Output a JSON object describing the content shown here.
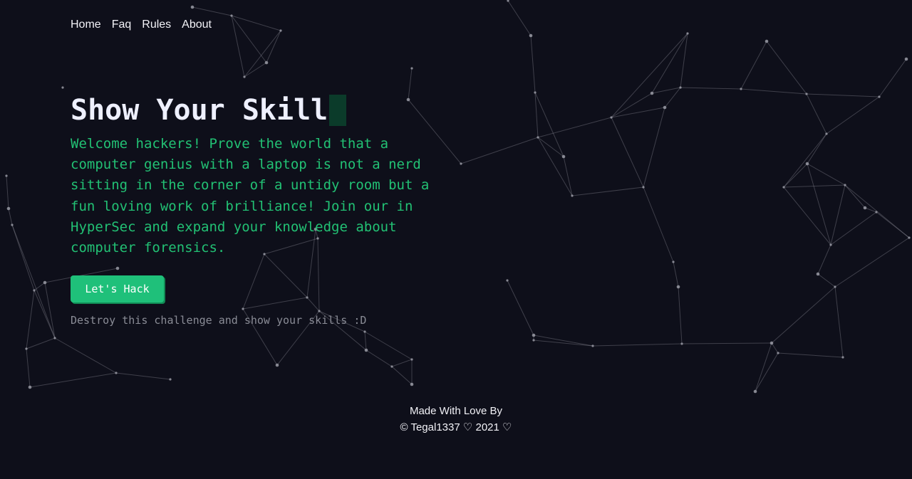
{
  "nav": {
    "items": [
      {
        "label": "Home"
      },
      {
        "label": "Faq"
      },
      {
        "label": "Rules"
      },
      {
        "label": "About"
      }
    ]
  },
  "hero": {
    "title": "Show Your Skill",
    "description": "Welcome hackers! Prove the world that a computer genius with a laptop is not a nerd sitting in the corner of a untidy room but a fun loving work of brilliance! Join our in HyperSec and expand your knowledge about computer forensics.",
    "button_label": "Let's Hack",
    "subtext": "Destroy this challenge and show your skills :D"
  },
  "footer": {
    "line1": "Made With Love By",
    "line2": "© Tegal1337 ♡ 2021 ♡"
  },
  "colors": {
    "background": "#0e0f1a",
    "accent": "#1fc07a",
    "description_text": "#22c174",
    "particle": "#9a9ba6"
  }
}
